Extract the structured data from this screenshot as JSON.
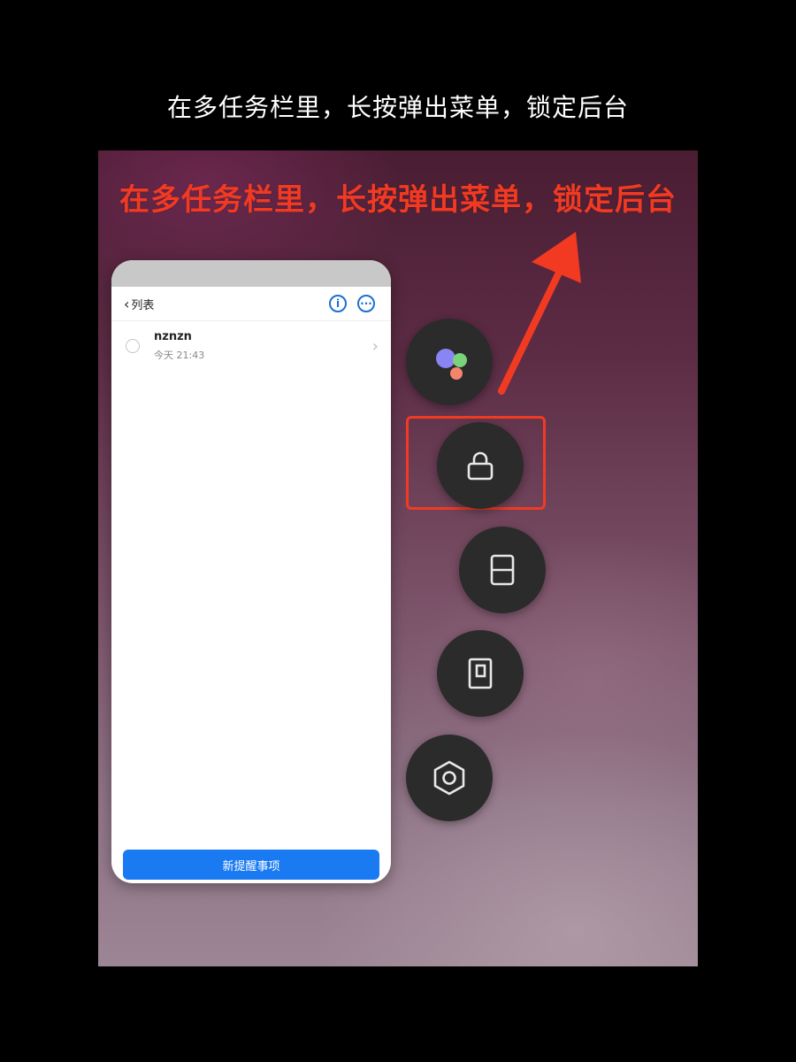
{
  "caption": "在多任务栏里，长按弹出菜单，锁定后台",
  "annotation": "在多任务栏里，长按弹出菜单，锁定后台",
  "colors": {
    "annotation": "#f23a22",
    "primary_button": "#1a7af2",
    "header_icons": "#1d6fd3",
    "fab_background": "#2b2b2b"
  },
  "app": {
    "header": {
      "back_label": "列表",
      "back_icon": "chevron-left-icon",
      "info_icon": "info-icon",
      "more_icon": "more-icon"
    },
    "items": [
      {
        "title": "nznzn",
        "time": "今天 21:43"
      }
    ],
    "new_button_label": "新提醒事项"
  },
  "floating_menu": [
    {
      "name": "assistant",
      "icon": "assistant-dots-icon"
    },
    {
      "name": "lock",
      "icon": "lock-icon",
      "highlighted": true
    },
    {
      "name": "split-screen",
      "icon": "split-screen-icon"
    },
    {
      "name": "small-window",
      "icon": "small-window-icon"
    },
    {
      "name": "settings",
      "icon": "settings-icon"
    }
  ]
}
